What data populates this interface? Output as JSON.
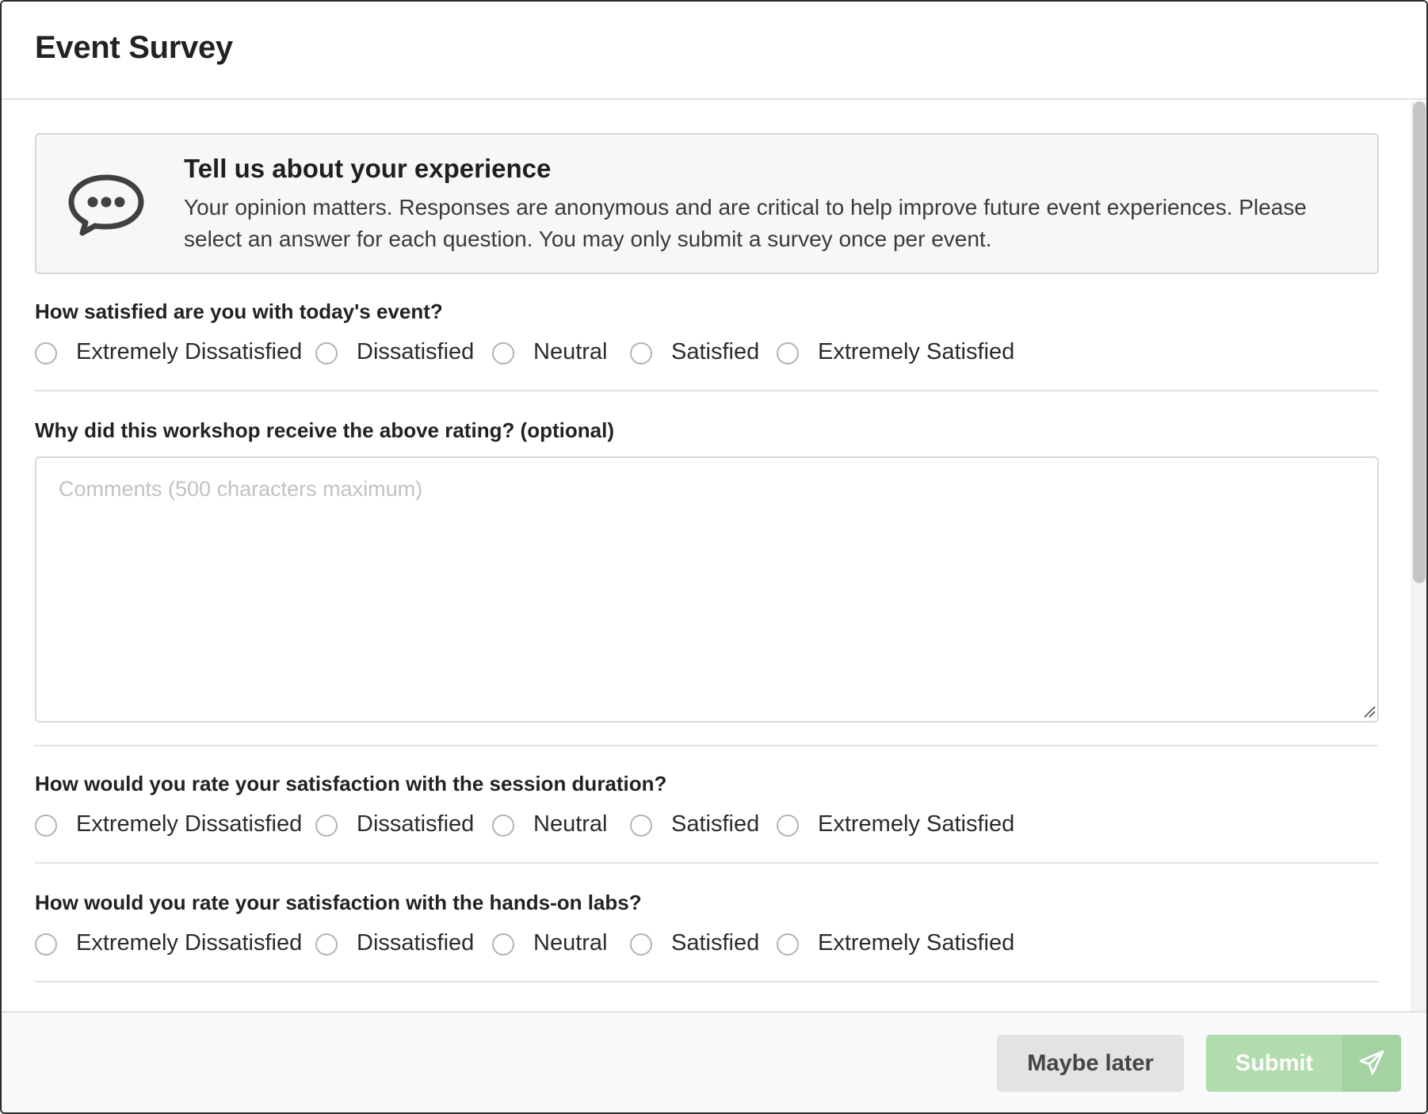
{
  "header": {
    "title": "Event Survey"
  },
  "intro": {
    "icon": "speech-bubble-ellipsis-icon",
    "title": "Tell us about your experience",
    "text": "Your opinion matters. Responses are anonymous and are critical to help improve future event experiences. Please select an answer for each question. You may only submit a survey once per event."
  },
  "questions": [
    {
      "label": "How satisfied are you with today's event?",
      "options": [
        "Extremely Dissatisfied",
        "Dissatisfied",
        "Neutral",
        "Satisfied",
        "Extremely Satisfied"
      ]
    },
    {
      "label": "Why did this workshop receive the above rating? (optional)",
      "placeholder": "Comments (500 characters maximum)"
    },
    {
      "label": "How would you rate your satisfaction with the session duration?",
      "options": [
        "Extremely Dissatisfied",
        "Dissatisfied",
        "Neutral",
        "Satisfied",
        "Extremely Satisfied"
      ]
    },
    {
      "label": "How would you rate your satisfaction with the hands-on labs?",
      "options": [
        "Extremely Dissatisfied",
        "Dissatisfied",
        "Neutral",
        "Satisfied",
        "Extremely Satisfied"
      ]
    }
  ],
  "footer": {
    "maybe_later": "Maybe later",
    "submit": "Submit",
    "submit_icon": "paper-plane-icon"
  },
  "colors": {
    "submit_bg": "#b1dcae",
    "submit_icon_bg": "#a4d2a1",
    "secondary_bg": "#e3e3e3",
    "info_bg": "#f7f7f7"
  }
}
